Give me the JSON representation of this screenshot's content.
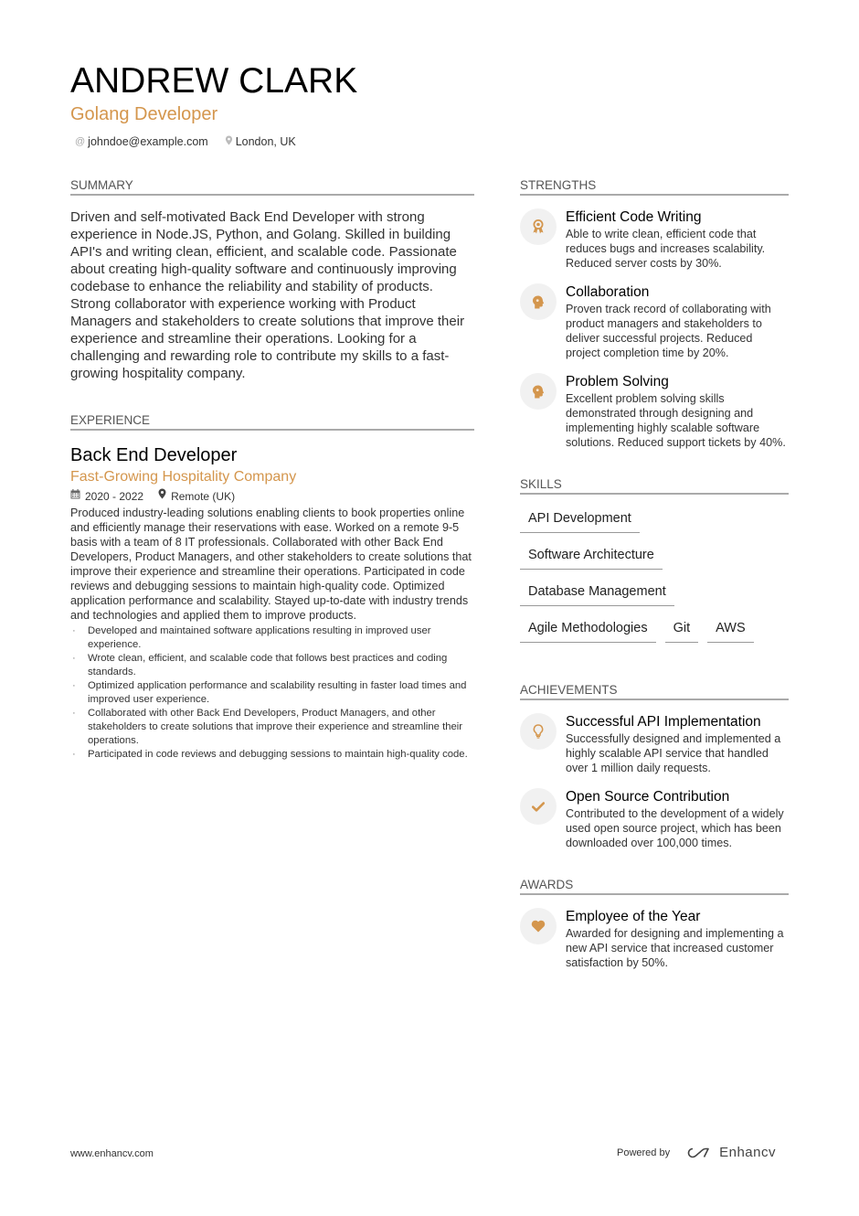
{
  "header": {
    "name": "ANDREW CLARK",
    "title": "Golang Developer",
    "contacts": [
      {
        "icon": "at-icon",
        "glyph": "@",
        "text": "johndoe@example.com"
      },
      {
        "icon": "location-pin-icon",
        "glyph": "⚲",
        "text": "London, UK"
      }
    ]
  },
  "colors": {
    "accent": "#d4964d",
    "rule": "#aaaaaa",
    "icon_bg": "#f1f1f1"
  },
  "summary": {
    "heading": "SUMMARY",
    "text": "Driven and self-motivated Back End Developer with strong experience in Node.JS, Python, and Golang. Skilled in building API's and writing clean, efficient, and scalable code. Passionate about creating high-quality software and continuously improving codebase to enhance the reliability and stability of products. Strong collaborator with experience working with Product Managers and stakeholders to create solutions that improve their experience and streamline their operations. Looking for a challenging and rewarding role to contribute my skills to a fast-growing hospitality company."
  },
  "experience": {
    "heading": "EXPERIENCE",
    "jobs": [
      {
        "title": "Back End Developer",
        "company": "Fast-Growing Hospitality Company",
        "dates": "2020 - 2022",
        "location": "Remote (UK)",
        "description": "Produced industry-leading solutions enabling clients to book properties online and efficiently manage their reservations with ease. Worked on a remote 9-5 basis with a team of 8 IT professionals. Collaborated with other Back End Developers, Product Managers, and other stakeholders to create solutions that improve their experience and streamline their operations. Participated in code reviews and debugging sessions to maintain high-quality code. Optimized application performance and scalability. Stayed up-to-date with industry trends and technologies and applied them to improve products.",
        "bullets": [
          "Developed and maintained software applications resulting in improved user experience.",
          "Wrote clean, efficient, and scalable code that follows best practices and coding standards.",
          "Optimized application performance and scalability resulting in faster load times and improved user experience.",
          "Collaborated with other Back End Developers, Product Managers, and other stakeholders to create solutions that improve their experience and streamline their operations.",
          "Participated in code reviews and debugging sessions to maintain high-quality code."
        ]
      }
    ]
  },
  "strengths": {
    "heading": "STRENGTHS",
    "items": [
      {
        "icon": "award-ribbon-icon",
        "title": "Efficient Code Writing",
        "desc": "Able to write clean, efficient code that reduces bugs and increases scalability. Reduced server costs by 30%."
      },
      {
        "icon": "head-brain-icon",
        "title": "Collaboration",
        "desc": "Proven track record of collaborating with product managers and stakeholders to deliver successful projects. Reduced project completion time by 20%."
      },
      {
        "icon": "head-brain-icon",
        "title": "Problem Solving",
        "desc": "Excellent problem solving skills demonstrated through designing and implementing highly scalable software solutions. Reduced support tickets by 40%."
      }
    ]
  },
  "skills": {
    "heading": "SKILLS",
    "items": [
      "API Development",
      "Software Architecture",
      "Database Management",
      "Agile Methodologies",
      "Git",
      "AWS"
    ]
  },
  "achievements": {
    "heading": "ACHIEVEMENTS",
    "items": [
      {
        "icon": "lightbulb-icon",
        "title": "Successful API Implementation",
        "desc": "Successfully designed and implemented a highly scalable API service that handled over 1 million daily requests."
      },
      {
        "icon": "checkmark-icon",
        "title": "Open Source Contribution",
        "desc": "Contributed to the development of a widely used open source project, which has been downloaded over 100,000 times."
      }
    ]
  },
  "awards": {
    "heading": "AWARDS",
    "items": [
      {
        "icon": "heart-icon",
        "title": "Employee of the Year",
        "desc": "Awarded for designing and implementing a new API service that increased customer satisfaction by 50%."
      }
    ]
  },
  "footer": {
    "website": "www.enhancv.com",
    "powered_by": "Powered by",
    "brand": "Enhancv"
  }
}
